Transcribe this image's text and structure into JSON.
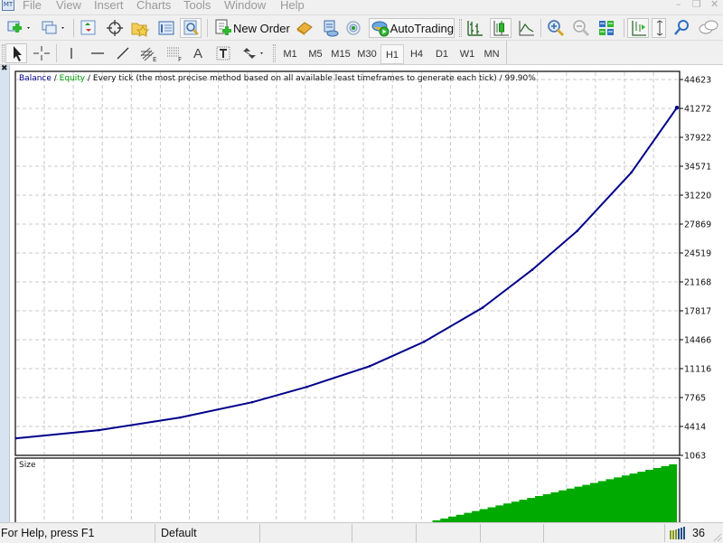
{
  "menubar": {
    "items": [
      "File",
      "View",
      "Insert",
      "Charts",
      "Tools",
      "Window",
      "Help"
    ],
    "window_controls": [
      "minimize",
      "restore",
      "close"
    ]
  },
  "toolbar1": {
    "new_order_label": "New Order",
    "autotrading_label": "AutoTrading",
    "icons": [
      "new-chart-icon",
      "profiles-icon",
      "market-watch-icon",
      "data-window-icon",
      "navigator-icon",
      "terminal-icon",
      "strategy-tester-icon",
      "new-order-icon",
      "metaeditor-icon",
      "market-icon",
      "signals-icon",
      "autotrading-icon",
      "bar-chart-icon",
      "candlesticks-icon",
      "line-chart-icon",
      "zoom-in-icon",
      "zoom-out-icon",
      "tile-windows-icon",
      "chart-shift-icon",
      "auto-scroll-icon",
      "search-icon",
      "chat-icon"
    ]
  },
  "toolbar2": {
    "text_tool_label": "A",
    "timeframes": [
      "M1",
      "M5",
      "M15",
      "M30",
      "H1",
      "H4",
      "D1",
      "W1",
      "MN"
    ],
    "active_timeframe": "H1"
  },
  "chart": {
    "legend": {
      "balance": "Balance",
      "sep1": " / ",
      "equity": "Equity",
      "rest": " / Every tick (the most precise method based on all available least timeframes to generate each tick) / 99.90%"
    },
    "size_label": "Size",
    "colors": {
      "balance": "#00008b",
      "equity": "#00a000",
      "size_fill": "#00aa00",
      "grid": "#c8c8c8"
    }
  },
  "chart_data": {
    "type": "line",
    "title": "Balance / Equity / Every tick (the most precise method based on all available least timeframes to generate each tick) / 99.90%",
    "xlabel": "",
    "ylabel": "",
    "y_ticks": [
      44623,
      41272,
      37922,
      34571,
      31220,
      27869,
      24519,
      21168,
      17817,
      14466,
      11116,
      7765,
      4414,
      1063
    ],
    "ylim": [
      1063,
      44623
    ],
    "grid": true,
    "series": [
      {
        "name": "Balance",
        "x": [
          0,
          0.125,
          0.248,
          0.357,
          0.44,
          0.535,
          0.617,
          0.706,
          0.781,
          0.849,
          0.931,
          1.0
        ],
        "values": [
          3046,
          3986,
          5448,
          7222,
          8997,
          11399,
          14217,
          18185,
          22570,
          27059,
          33845,
          41361
        ]
      }
    ],
    "subchart": {
      "name": "Size",
      "type": "bar",
      "start_fraction": 0.63,
      "steps": 31,
      "max_fraction_of_panel": 0.93
    }
  },
  "statusbar": {
    "help": "For Help, press F1",
    "profile": "Default",
    "connection_value": "36"
  }
}
